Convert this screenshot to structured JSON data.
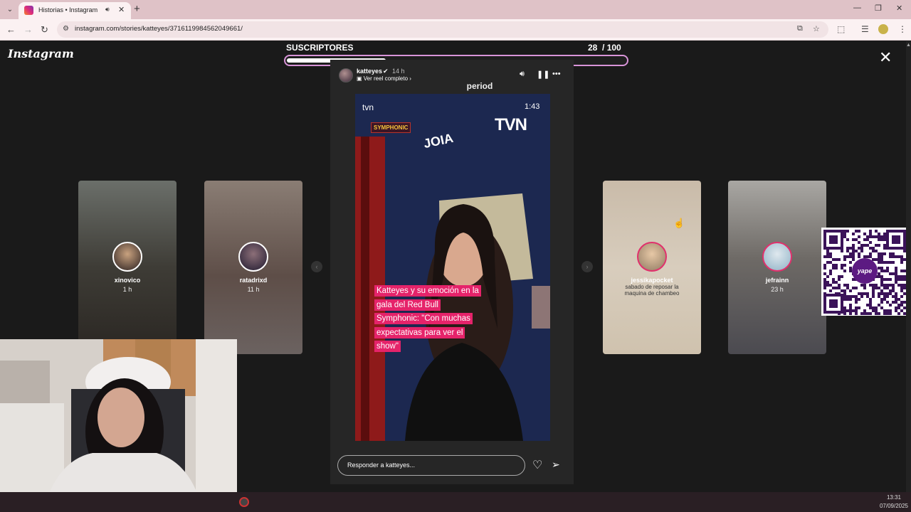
{
  "browser": {
    "tab_title": "Historias • Instagram",
    "url": "instagram.com/stories/katteyes/3716119984562049661/"
  },
  "instagram": {
    "logo": "Instagram",
    "side_stories": [
      {
        "username": "xinovico",
        "time": "1 h"
      },
      {
        "username": "ratadrixd",
        "time": "11 h"
      },
      {
        "username": "jessikapocket",
        "caption": "sabado de reposar la maquina de chambeo"
      },
      {
        "username": "jefrainn",
        "time": "23 h"
      }
    ],
    "story": {
      "username": "katteyes",
      "time": "14 h",
      "reel_link": "Ver reel completo",
      "overlay_text": "period",
      "video_channel": "tvn",
      "video_time": "1:43",
      "video_logo": "TVN",
      "video_brand": "JOIA",
      "video_event": "SYMPHONIC",
      "caption": "Katteyes y su emoción en la gala del Red Bull Symphonic: \"Con muchas expectativas para ver el show\"",
      "reply_placeholder": "Responder a katteyes..."
    }
  },
  "stream_overlay": {
    "label": "SUSCRIPTORES",
    "count": "28",
    "goal": "/ 100",
    "progress": 0.28
  },
  "qr_badge": "yape",
  "taskbar": {
    "time": "13:31",
    "date": "07/09/2025"
  },
  "colors": {
    "caption_bg": "#e5236a",
    "progress_border": "#d894d8",
    "tab_strip": "#dfc2c7"
  }
}
